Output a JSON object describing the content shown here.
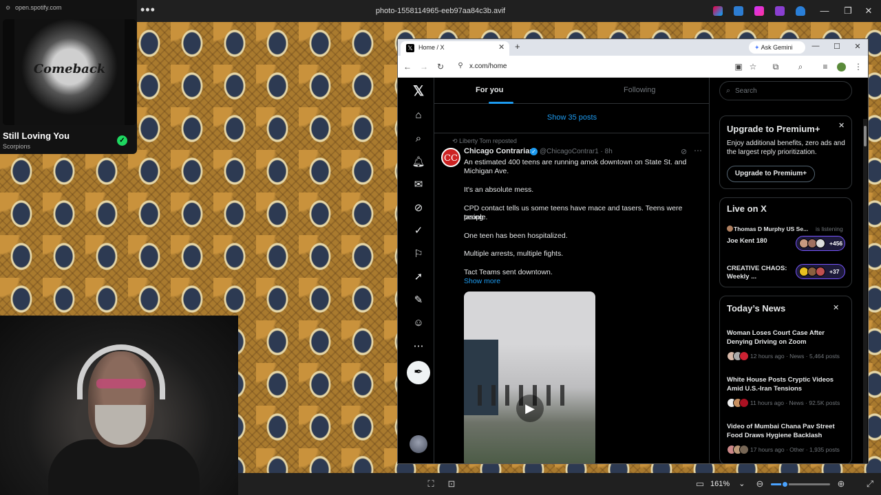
{
  "viewer": {
    "filename": "photo-1558114965-eeb97aa84c3b.avif",
    "zoom": "161%",
    "zoom_level_fraction": 0.23
  },
  "spotify": {
    "url": "open.spotify.com",
    "album_art_text": "Comeback",
    "track": "Still Loving You",
    "artist": "Scorpions"
  },
  "browser": {
    "tab_title": "Home / X",
    "url": "x.com/home",
    "gemini_label": "Ask Gemini"
  },
  "x": {
    "tabs": {
      "for_you": "For you",
      "following": "Following"
    },
    "show_posts": "Show 35 posts",
    "post": {
      "repost_by": "Liberty Tom reposted",
      "avatar_text": "CC",
      "name": "Chicago Contrarian",
      "handle": "@ChicagoContrar1 · 8h",
      "lines": [
        "An estimated 400 teens are running amok downtown on State St. and",
        "Michigan Ave.",
        "It's an absolute mess.",
        "CPD contact tells us some teens have mace and tasers. Teens were tasing",
        "people.",
        "One teen has been hospitalized.",
        "Multiple arrests, multiple fights.",
        "Tact Teams sent downtown."
      ],
      "show_more": "Show more"
    },
    "sidebar": {
      "search_placeholder": "Search",
      "premium": {
        "title": "Upgrade to Premium+",
        "desc": "Enjoy additional benefits, zero ads and the largest reply prioritization.",
        "button": "Upgrade to Premium+"
      },
      "live": {
        "title": "Live on X",
        "host": "Thomas D Murphy US Se...",
        "listening": "is listening",
        "space1": "Joe Kent 180",
        "space1_count": "+456",
        "space2": "CREATIVE CHAOS: Weekly ...",
        "space2_count": "+37"
      },
      "news": {
        "title": "Today’s News",
        "items": [
          {
            "title": "Woman Loses Court Case After Denying Driving on Zoom",
            "meta": "12 hours ago · News · 5,464 posts"
          },
          {
            "title": "White House Posts Cryptic Videos Amid U.S.-Iran Tensions",
            "meta": "11 hours ago · News · 92.5K posts"
          },
          {
            "title": "Video of Mumbai Chana Pav Street Food Draws Hygiene Backlash",
            "meta": "17 hours ago · Other · 1,935 posts"
          }
        ]
      }
    }
  },
  "colors": {
    "x_blue": "#1d9bf0",
    "spotify_green": "#1ed760",
    "live_purple": "#7856ff"
  }
}
